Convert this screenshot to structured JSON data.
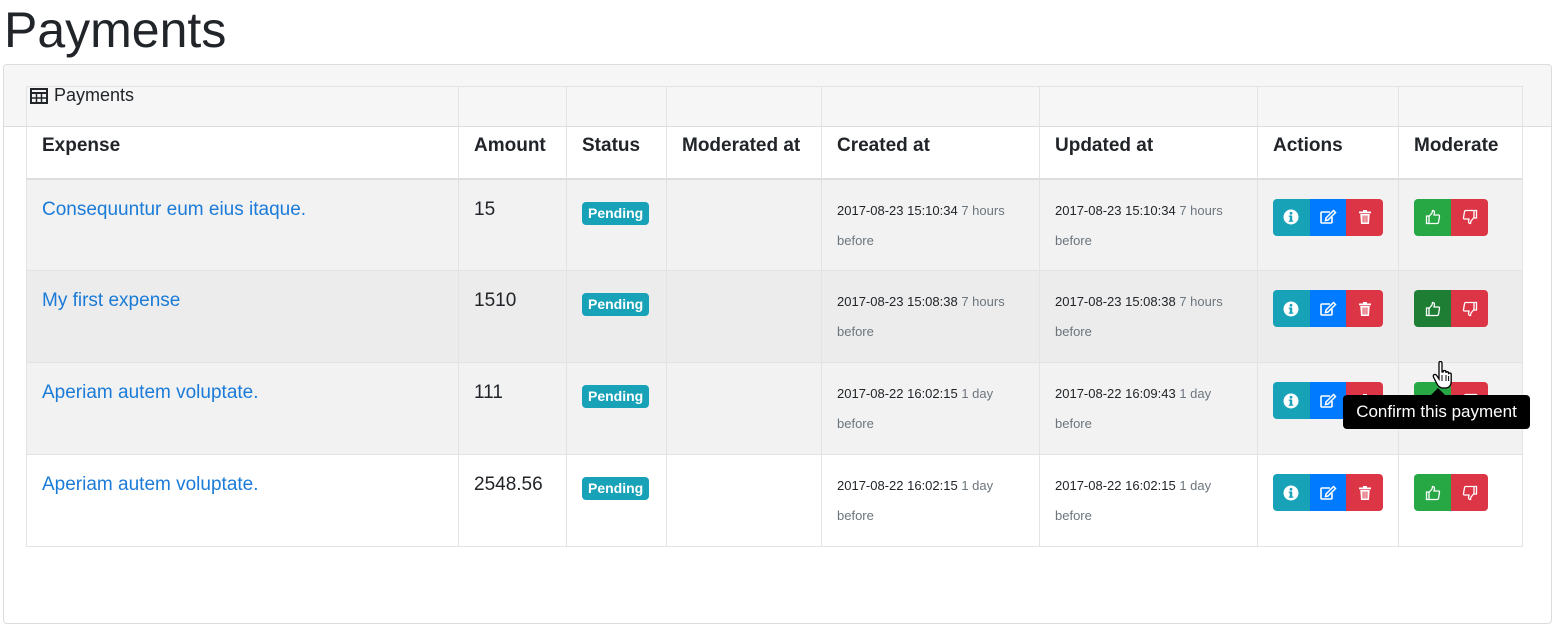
{
  "page": {
    "title": "Payments"
  },
  "card": {
    "header_label": "Payments"
  },
  "table": {
    "headers": [
      "Expense",
      "Amount",
      "Status",
      "Moderated at",
      "Created at",
      "Updated at",
      "Actions",
      "Moderate"
    ],
    "rows": [
      {
        "expense": "Consequuntur eum eius itaque.",
        "amount": "15",
        "status": "Pending",
        "moderated_at": "",
        "created_date": "2017-08-23 15:10:34",
        "created_rel_1": "7 hours",
        "created_rel_2": "before",
        "updated_date": "2017-08-23 15:10:34",
        "updated_rel_1": "7 hours",
        "updated_rel_2": "before"
      },
      {
        "expense": "My first expense",
        "amount": "1510",
        "status": "Pending",
        "moderated_at": "",
        "created_date": "2017-08-23 15:08:38",
        "created_rel_1": "7 hours",
        "created_rel_2": "before",
        "updated_date": "2017-08-23 15:08:38",
        "updated_rel_1": "7 hours",
        "updated_rel_2": "before"
      },
      {
        "expense": "Aperiam autem voluptate.",
        "amount": "111",
        "status": "Pending",
        "moderated_at": "",
        "created_date": "2017-08-22 16:02:15",
        "created_rel_1": "1 day",
        "created_rel_2": "before",
        "updated_date": "2017-08-22 16:09:43",
        "updated_rel_1": "1 day",
        "updated_rel_2": "before"
      },
      {
        "expense": "Aperiam autem voluptate.",
        "amount": "2548.56",
        "status": "Pending",
        "moderated_at": "",
        "created_date": "2017-08-22 16:02:15",
        "created_rel_1": "1 day",
        "created_rel_2": "before",
        "updated_date": "2017-08-22 16:02:15",
        "updated_rel_1": "1 day",
        "updated_rel_2": "before"
      }
    ]
  },
  "tooltip": {
    "text": "Confirm this payment"
  },
  "colors": {
    "info": "#17a2b8",
    "primary": "#007bff",
    "danger": "#dc3545",
    "success": "#28a745",
    "link": "#1a7bd8"
  },
  "icons": {
    "header": "table-icon",
    "info": "info-icon",
    "edit": "edit-icon",
    "delete": "trash-icon",
    "confirm": "thumbs-up-icon",
    "reject": "thumbs-down-icon"
  }
}
